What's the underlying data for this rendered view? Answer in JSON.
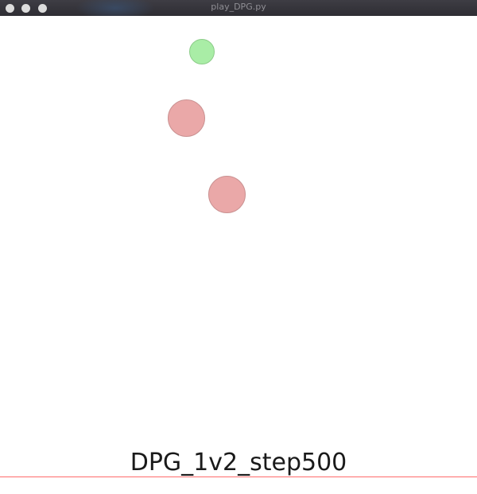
{
  "window": {
    "title": "play_DPG.py"
  },
  "scene": {
    "caption": "DPG_1v2_step500",
    "agents": [
      {
        "role": "good",
        "color": "#a9eda6"
      },
      {
        "role": "adversary",
        "color": "#eaa8a8"
      },
      {
        "role": "adversary",
        "color": "#eaa8a8"
      }
    ],
    "baseline_color": "#ff6b6b"
  }
}
